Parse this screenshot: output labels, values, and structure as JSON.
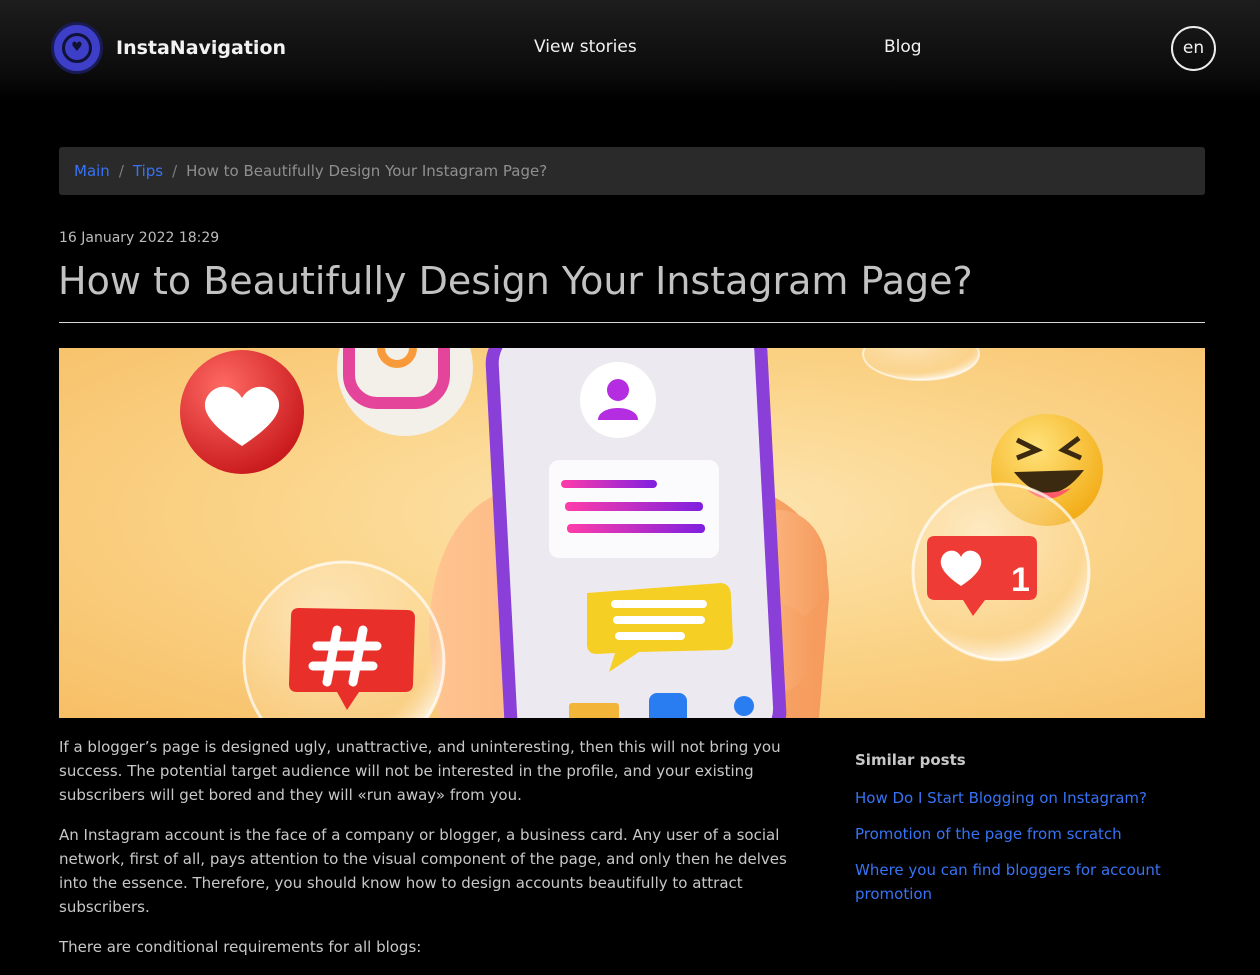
{
  "header": {
    "brand": "InstaNavigation",
    "nav": [
      "View stories",
      "Blog"
    ],
    "lang": "en"
  },
  "breadcrumb": [
    "Main",
    "Tips",
    "How to Beautifully Design Your Instagram Page?"
  ],
  "article": {
    "date": "16 January 2022 18:29",
    "title": "How to Beautifully Design Your Instagram Page?",
    "paragraphs": [
      "If a blogger’s page is designed ugly, unattractive, and uninteresting, then this will not bring you success. The potential target audience will not be interested in the profile, and your existing subscribers will get bored and they will «run away» from you.",
      "An Instagram account is the face of a company or blogger, a business card. Any user of a social network, first of all, pays attention to the visual component of the page, and only then he delves into the essence. Therefore, you should know how to design accounts beautifully to attract subscribers.",
      "There are conditional requirements for all blogs:"
    ]
  },
  "hero": {
    "like_count": "1"
  },
  "sidebar": {
    "title": "Similar posts",
    "links": [
      "How Do I Start Blogging on Instagram?",
      "Promotion of the page from scratch",
      "Where you can find bloggers for account promotion"
    ]
  },
  "colors": {
    "accent": "#3773f5",
    "brand": "#3d3fc8",
    "background": "#000000"
  }
}
